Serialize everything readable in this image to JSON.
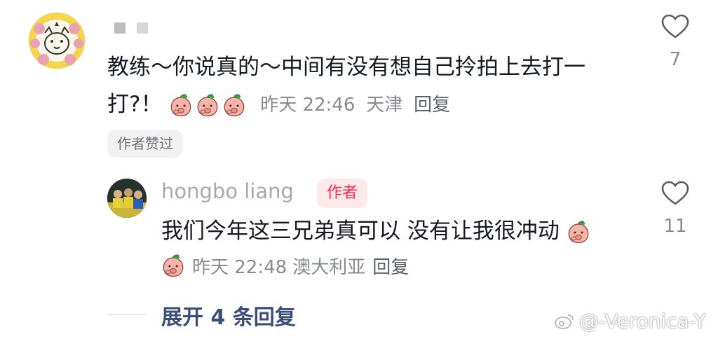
{
  "comment1": {
    "username_masked": "▪ ▪",
    "text": "教练～你说真的～中间有没有想自己拎拍上去打一打?！",
    "emoji_count": 3,
    "time": "昨天 22:46",
    "location": "天津",
    "reply_label": "回复",
    "badge": "作者赞过",
    "likes": "7"
  },
  "reply1": {
    "username": "hongbo liang",
    "author_tag": "作者",
    "text": "我们今年这三兄弟真可以 没有让我很冲动",
    "time": "昨天 22:48",
    "location": "澳大利亚",
    "reply_label": "回复",
    "likes": "11"
  },
  "expand_replies": "展开 4 条回复",
  "watermark": "@-Veronica-Y",
  "icons": {
    "like": "heart-outline-icon",
    "emoji": "peach-face-emoji-icon",
    "watermark": "weibo-icon"
  },
  "colors": {
    "text": "#161823",
    "muted": "#8a8b91",
    "author_accent": "#fe2c55",
    "expand_link": "#3d4d7a"
  }
}
